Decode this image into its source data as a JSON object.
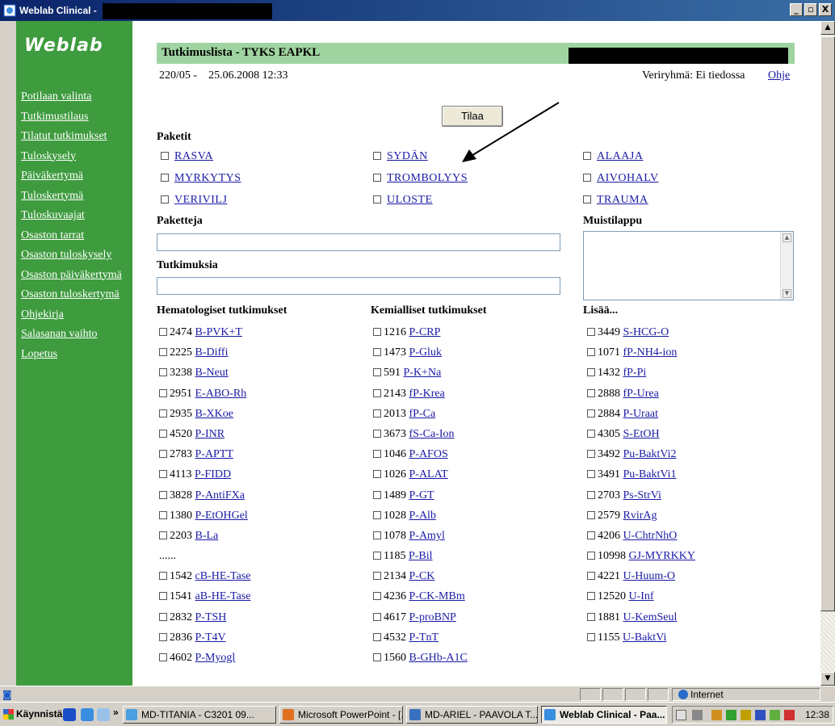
{
  "window": {
    "title": "Weblab Clinical - ",
    "min": "_",
    "max": "▫",
    "close": "X"
  },
  "sidebar": {
    "logo": "Weblab",
    "items": [
      "Potilaan valinta",
      "Tutkimustilaus",
      "Tilatut tutkimukset",
      "Tuloskysely",
      "Päiväkertymä",
      "Tuloskertymä",
      "Tuloskuvaajat",
      "Osaston tarrat",
      "Osaston tuloskysely",
      "Osaston päiväkertymä",
      "Osaston tuloskertymä",
      "Ohjekirja",
      "Salasanan vaihto",
      "Lopetus"
    ]
  },
  "header": {
    "title": "Tutkimuslista - TYKS EAPKL",
    "date_from": "220/05 -",
    "date_time": "25.06.2008 12:33",
    "blood_type": "Veriryhmä: Ei tiedossa",
    "help": "Ohje"
  },
  "order_button": "Tilaa",
  "packages": {
    "label": "Paketit",
    "items": [
      "RASVA",
      "SYDÄN",
      "ALAAJA",
      "MYRKYTYS",
      "TROMBOLYYS",
      "AIVOHALV",
      "VERIVILJ",
      "ULOSTE",
      "TRAUMA"
    ]
  },
  "fields": {
    "packages_label": "Paketteja",
    "tests_label": "Tutkimuksia",
    "notes_label": "Muistilappu",
    "packages_value": "",
    "tests_value": "",
    "notes_value": ""
  },
  "columns": {
    "hematology": {
      "title": "Hematologiset tutkimukset",
      "rows": [
        {
          "code": "2474",
          "name": "B-PVK+T"
        },
        {
          "code": "2225",
          "name": "B-Diffi"
        },
        {
          "code": "3238",
          "name": "B-Neut"
        },
        {
          "code": "2951",
          "name": "E-ABO-Rh"
        },
        {
          "code": "2935",
          "name": "B-XKoe"
        },
        {
          "code": "4520",
          "name": "P-INR"
        },
        {
          "code": "2783",
          "name": "P-APTT"
        },
        {
          "code": "4113",
          "name": "P-FIDD"
        },
        {
          "code": "3828",
          "name": "P-AntiFXa"
        },
        {
          "code": "1380",
          "name": "P-EtOHGel"
        },
        {
          "code": "2203",
          "name": "B-La"
        },
        {
          "ellipsis": "......"
        },
        {
          "code": "1542",
          "name": "cB-HE-Tase"
        },
        {
          "code": "1541",
          "name": "aB-HE-Tase"
        },
        {
          "code": "2832",
          "name": "P-TSH"
        },
        {
          "code": "2836",
          "name": "P-T4V"
        },
        {
          "code": "4602",
          "name": "P-Myogl"
        }
      ]
    },
    "chemistry": {
      "title": "Kemialliset tutkimukset",
      "rows": [
        {
          "code": "1216",
          "name": "P-CRP"
        },
        {
          "code": "1473",
          "name": "P-Gluk"
        },
        {
          "code": "591",
          "name": "P-K+Na"
        },
        {
          "code": "2143",
          "name": "fP-Krea"
        },
        {
          "code": "2013",
          "name": "fP-Ca"
        },
        {
          "code": "3673",
          "name": "fS-Ca-Ion"
        },
        {
          "code": "1046",
          "name": "P-AFOS"
        },
        {
          "code": "1026",
          "name": "P-ALAT"
        },
        {
          "code": "1489",
          "name": "P-GT"
        },
        {
          "code": "1028",
          "name": "P-Alb"
        },
        {
          "code": "1078",
          "name": "P-Amyl"
        },
        {
          "code": "1185",
          "name": "P-Bil"
        },
        {
          "code": "2134",
          "name": "P-CK"
        },
        {
          "code": "4236",
          "name": "P-CK-MBm"
        },
        {
          "code": "4617",
          "name": "P-proBNP"
        },
        {
          "code": "4532",
          "name": "P-TnT"
        },
        {
          "code": "1560",
          "name": "B-GHb-A1C"
        }
      ]
    },
    "more": {
      "title": "Lisää...",
      "rows": [
        {
          "code": "3449",
          "name": "S-HCG-O"
        },
        {
          "code": "1071",
          "name": "fP-NH4-ion"
        },
        {
          "code": "1432",
          "name": "fP-Pi"
        },
        {
          "code": "2888",
          "name": "fP-Urea"
        },
        {
          "code": "2884",
          "name": "P-Uraat"
        },
        {
          "code": "4305",
          "name": "S-EtOH"
        },
        {
          "code": "3492",
          "name": "Pu-BaktVi2"
        },
        {
          "code": "3491",
          "name": "Pu-BaktVi1"
        },
        {
          "code": "2703",
          "name": "Ps-StrVi"
        },
        {
          "code": "2579",
          "name": "RvirAg"
        },
        {
          "code": "4206",
          "name": "U-ChtrNhO"
        },
        {
          "code": "10998",
          "name": "GJ-MYRKKY"
        },
        {
          "code": "4221",
          "name": "U-Huum-O"
        },
        {
          "code": "12520",
          "name": "U-Inf"
        },
        {
          "code": "1881",
          "name": "U-KemSeul"
        },
        {
          "code": "1155",
          "name": "U-BaktVi"
        }
      ]
    }
  },
  "statusbar": {
    "zone": "Internet"
  },
  "taskbar": {
    "start": "Käynnistä",
    "chevron": "»",
    "tasks": [
      "MD-TITANIA - C3201 09...",
      "Microsoft PowerPoint - [...",
      "MD-ARIEL - PAAVOLA T...",
      "Weblab Clinical - Paa..."
    ],
    "clock": "12:38"
  },
  "colors": {
    "sidebar": "#3e9b3e",
    "headband": "#9fd4a0",
    "link": "#1a1aa6"
  }
}
